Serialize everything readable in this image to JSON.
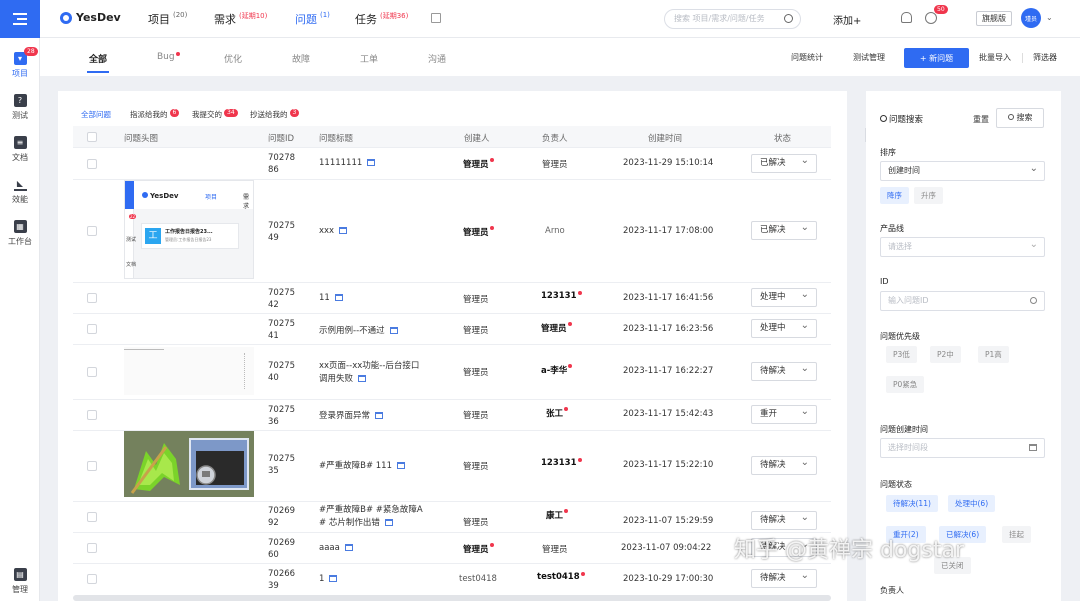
{
  "app": {
    "logo_text": "YesDev"
  },
  "sidebar": {
    "items": [
      {
        "label": "项目",
        "badge": "28",
        "icon": "project-icon"
      },
      {
        "label": "测试",
        "icon": "test-icon"
      },
      {
        "label": "文档",
        "icon": "doc-icon"
      },
      {
        "label": "效能",
        "icon": "efficiency-icon"
      },
      {
        "label": "工作台",
        "icon": "workbench-icon"
      },
      {
        "label": "管理",
        "icon": "manage-icon"
      }
    ]
  },
  "topnav": {
    "items": [
      {
        "label": "项目",
        "count": "(20)"
      },
      {
        "label": "需求",
        "count": "(延期10)"
      },
      {
        "label": "问题",
        "count": "(1)"
      },
      {
        "label": "任务",
        "count": "(延期36)"
      }
    ],
    "search_placeholder": "搜索 项目/需求/问题/任务",
    "add_label": "添加+",
    "notif_badge": "50",
    "edition_label": "旗舰版",
    "avatar_text": "瑾员"
  },
  "tabs": {
    "items": [
      "全部",
      "Bug",
      "优化",
      "故障",
      "工单",
      "沟通"
    ],
    "right_links": [
      "问题统计",
      "测试管理"
    ],
    "new_button": "+ 新问题",
    "import_label": "批量导入",
    "filter_label": "筛选器"
  },
  "filters": [
    {
      "label": "全部问题"
    },
    {
      "label": "指派给我的",
      "badge": "6"
    },
    {
      "label": "我提交的",
      "badge": "34"
    },
    {
      "label": "抄送给我的",
      "badge": "3"
    }
  ],
  "table": {
    "columns": [
      "问题头图",
      "问题ID",
      "问题标题",
      "创建人",
      "负责人",
      "创建时间",
      "状态"
    ],
    "rows": [
      {
        "id1": "70278",
        "id2": "86",
        "title": "11111111",
        "creator": "管理员",
        "owner": "管理员",
        "time": "2023-11-29 15:10:14",
        "status": "已解决"
      },
      {
        "id1": "70275",
        "id2": "49",
        "title": "xxx",
        "creator": "管理员",
        "owner": "Arno",
        "time": "2023-11-17 17:08:00",
        "status": "已解决",
        "thumb": {
          "logo": "YesDev",
          "nav1": "项目",
          "nav2": "需求",
          "badge": "22",
          "text1": "工作报告日报告23...",
          "text2": "管理员:工作报告日报告23",
          "side1": "测试",
          "side2": "文档"
        }
      },
      {
        "id1": "70275",
        "id2": "42",
        "title": "11",
        "creator": "管理员",
        "owner": "123131",
        "time": "2023-11-17 16:41:56",
        "status": "处理中"
      },
      {
        "id1": "70275",
        "id2": "41",
        "title": "示例用例--不通过",
        "creator": "管理员",
        "owner": "管理员",
        "time": "2023-11-17 16:23:56",
        "status": "处理中"
      },
      {
        "id1": "70275",
        "id2": "40",
        "title": "xx页面--xx功能--后台接口",
        "title2": "调用失败",
        "creator": "管理员",
        "owner": "a-李华",
        "time": "2023-11-17 16:22:27",
        "status": "待解决"
      },
      {
        "id1": "70275",
        "id2": "36",
        "title": "登录界面异常",
        "creator": "管理员",
        "owner": "张工",
        "time": "2023-11-17 15:42:43",
        "status": "重开"
      },
      {
        "id1": "70275",
        "id2": "35",
        "title": "#严重故障B# 111",
        "creator": "管理员",
        "owner": "123131",
        "time": "2023-11-17 15:22:10",
        "status": "待解决"
      },
      {
        "id1": "70269",
        "id2": "92",
        "title": "#严重故障B# #紧急故障A",
        "title2": "# 芯片制作出错",
        "creator": "管理员",
        "owner": "康工",
        "time": "2023-11-07 15:29:59",
        "status": "待解决"
      },
      {
        "id1": "70269",
        "id2": "60",
        "title": "aaaa",
        "creator": "管理员",
        "owner": "管理员",
        "time": "2023-11-07 09:04:22",
        "status": "待解决"
      },
      {
        "id1": "70266",
        "id2": "39",
        "title": "1",
        "creator": "test0418",
        "owner": "test0418",
        "time": "2023-10-29 17:00:30",
        "status": "待解决"
      }
    ]
  },
  "rpanel": {
    "title": "问题搜索",
    "reset": "重置",
    "search": "搜索",
    "sort_label": "排序",
    "sort_value": "创建时间",
    "order_desc": "降序",
    "order_asc": "升序",
    "product_label": "产品线",
    "product_placeholder": "请选择",
    "id_label": "ID",
    "id_placeholder": "输入问题ID",
    "priority_label": "问题优先级",
    "priorities": [
      "P3低",
      "P2中",
      "P1高",
      "P0紧急"
    ],
    "created_label": "问题创建时间",
    "created_placeholder": "选择时间段",
    "status_label": "问题状态",
    "statuses": [
      "待解决(11)",
      "处理中(6)",
      "重开(2)",
      "已解决(6)",
      "挂起",
      "已关闭"
    ],
    "owner_label": "负责人"
  },
  "watermark": "知乎 @黄禅宗 dogstar"
}
